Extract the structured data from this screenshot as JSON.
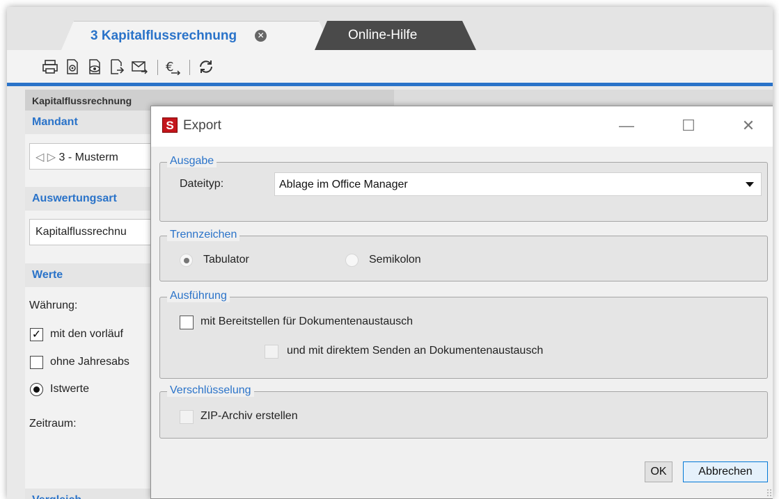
{
  "tabs": {
    "active_label": "3 Kapitalflussrechnung",
    "help_label": "Online-Hilfe"
  },
  "toolbar": {
    "buttons": [
      "print-icon",
      "print-settings-icon",
      "preview-icon",
      "export-icon",
      "email-icon",
      "currency-icon",
      "refresh-icon"
    ]
  },
  "left_panel": {
    "header": "Kapitalflussrechnung",
    "mandant_title": "Mandant",
    "mandant_value": "3 - Musterm",
    "auswertungsart_title": "Auswertungsart",
    "auswertungsart_value": "Kapitalflussrechnu",
    "werte_title": "Werte",
    "waehrung_label": "Währung:",
    "check_vorlaeufig": "mit den vorläuf",
    "check_vorlaeufig_checked": true,
    "check_jahresabs": "ohne Jahresabs",
    "check_jahresabs_checked": false,
    "radio_istwerte": "Istwerte",
    "radio_istwerte_selected": true,
    "zeitraum_label": "Zeitraum:",
    "vergleich_title": "Vergleich"
  },
  "dialog": {
    "title": "Export",
    "logo_letter": "S",
    "ausgabe": {
      "legend": "Ausgabe",
      "dateityp_label": "Dateityp:",
      "dateityp_value": "Ablage im Office Manager"
    },
    "trennzeichen": {
      "legend": "Trennzeichen",
      "option_tab": "Tabulator",
      "option_semikolon": "Semikolon",
      "selected": "Tabulator"
    },
    "ausfuehrung": {
      "legend": "Ausführung",
      "check_bereitstellen": "mit Bereitstellen für Dokumentenaustausch",
      "check_senden": "und mit direktem Senden an Dokumentenaustausch"
    },
    "verschluesselung": {
      "legend": "Verschlüsselung",
      "check_zip": "ZIP-Archiv erstellen"
    },
    "ok_label": "OK",
    "cancel_label": "Abbrechen"
  },
  "colors": {
    "accent": "#2a73c9",
    "tab_dark": "#4a4a4a",
    "brand_red": "#c4161c"
  }
}
